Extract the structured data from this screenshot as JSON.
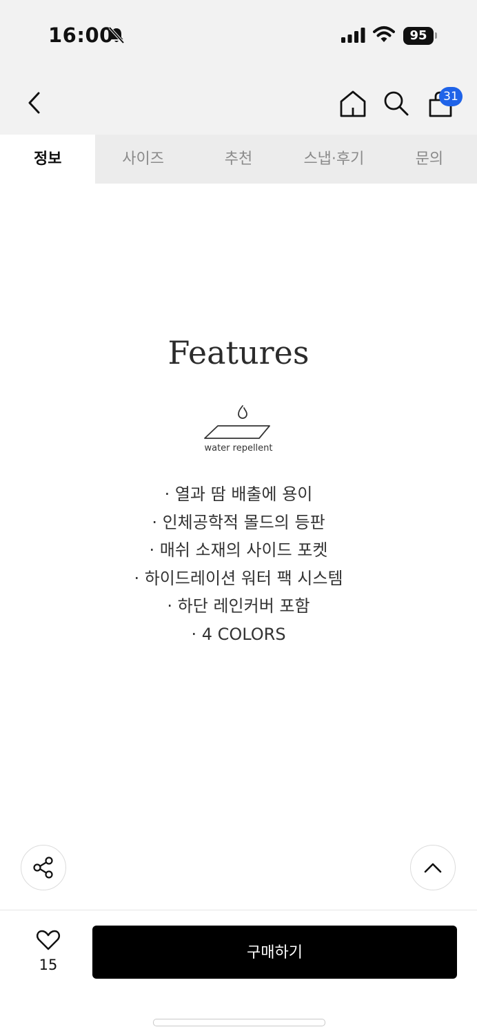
{
  "status_bar": {
    "time": "16:00",
    "battery": "95"
  },
  "nav": {
    "cart_count": "31"
  },
  "tabs": [
    {
      "label": "정보",
      "active": true
    },
    {
      "label": "사이즈",
      "active": false
    },
    {
      "label": "추천",
      "active": false
    },
    {
      "label": "스냅·후기",
      "active": false
    },
    {
      "label": "문의",
      "active": false
    }
  ],
  "content": {
    "title": "Features",
    "water_label": "water repellent",
    "features": [
      "· 열과 땀 배출에 용이",
      "· 인체공학적 몰드의 등판",
      "· 매쉬 소재의 사이드 포켓",
      "· 하이드레이션 워터 팩 시스템",
      "· 하단 레인커버 포함",
      "· 4 COLORS"
    ]
  },
  "bottom_bar": {
    "like_count": "15",
    "buy_label": "구매하기"
  },
  "colors": {
    "accent_badge": "#1f63e8",
    "buy_button_bg": "#000000",
    "header_bg": "#f2f2f2"
  },
  "icons": [
    "bell-slash-icon",
    "signal-icon",
    "wifi-icon",
    "back-icon",
    "home-icon",
    "search-icon",
    "shopping-bag-icon",
    "water-repellent-icon",
    "share-icon",
    "chevron-up-icon",
    "heart-icon"
  ]
}
